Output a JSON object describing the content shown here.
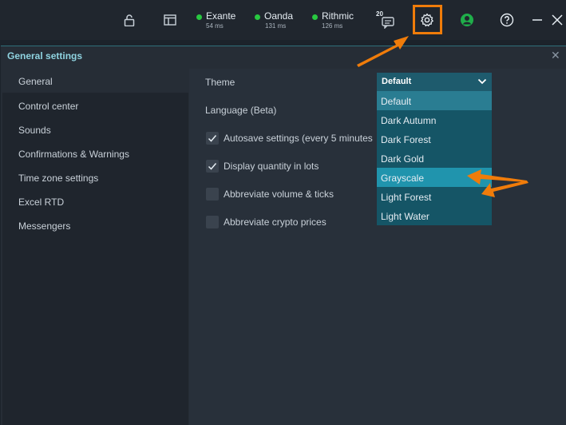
{
  "topbar": {
    "connections": [
      {
        "name": "Exante",
        "ms": "54 ms"
      },
      {
        "name": "Oanda",
        "ms": "131 ms"
      },
      {
        "name": "Rithmic",
        "ms": "126 ms"
      }
    ],
    "notification_count": "20",
    "status_color": "#28c840",
    "highlight_color": "#f07c0a",
    "icons": [
      "lock-icon",
      "layout-icon",
      "chat-icon",
      "gear-icon",
      "user-icon",
      "help-icon",
      "minimize-icon",
      "close-icon"
    ]
  },
  "window": {
    "title": "General settings",
    "sidebar": {
      "items": [
        "General",
        "Control center",
        "Sounds",
        "Confirmations & Warnings",
        "Time zone settings",
        "Excel RTD",
        "Messengers"
      ]
    },
    "content": {
      "theme_label": "Theme",
      "language_label": "Language (Beta)",
      "checkboxes": [
        {
          "label": "Autosave settings (every 5 minutes",
          "checked": true
        },
        {
          "label": "Display quantity in lots",
          "checked": true
        },
        {
          "label": "Abbreviate volume & ticks",
          "checked": false
        },
        {
          "label": "Abbreviate crypto prices",
          "checked": false
        }
      ],
      "theme_select": {
        "value": "Default",
        "options": [
          "Default",
          "Dark Autumn",
          "Dark Forest",
          "Dark Gold",
          "Grayscale",
          "Light Forest",
          "Light Water"
        ],
        "highlighted": "Grayscale"
      }
    }
  }
}
